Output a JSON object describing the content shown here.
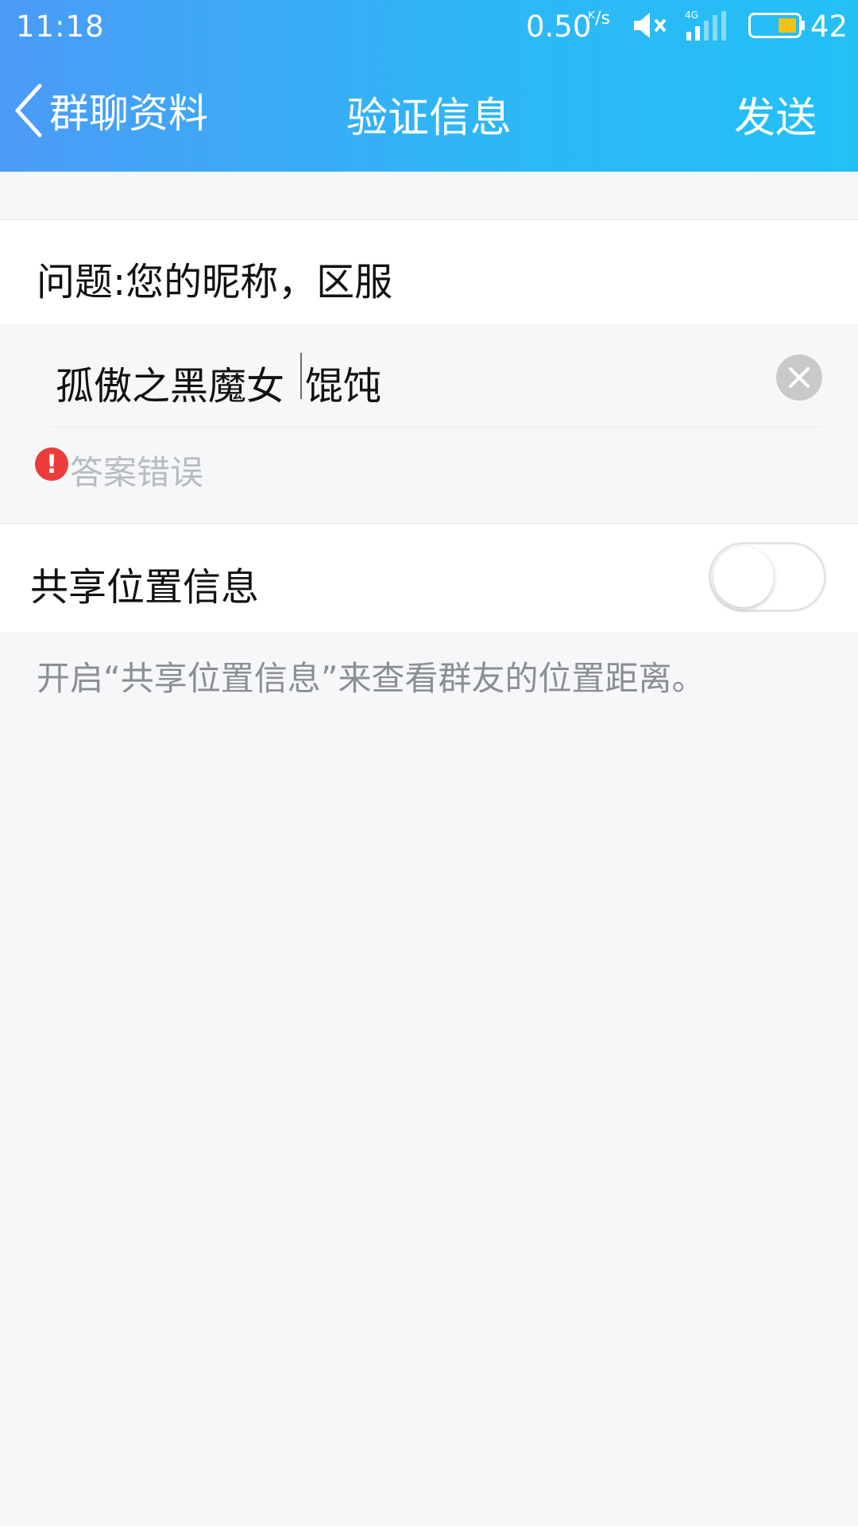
{
  "status_bar": {
    "time": "11:18",
    "network_speed": "0.50",
    "network_speed_unit": "K/s",
    "signal_type": "4G",
    "battery_level": "42",
    "icons": [
      "mute-icon",
      "signal-icon",
      "battery-icon"
    ]
  },
  "nav": {
    "back_label": "群聊资料",
    "title": "验证信息",
    "send_label": "发送"
  },
  "form": {
    "question": "问题:您的昵称，区服",
    "answer_part1": "孤傲之黑魔女 ",
    "answer_part2": "馄饨",
    "error_text": "答案错误",
    "error_icon_glyph": "!"
  },
  "share_location": {
    "label": "共享位置信息",
    "enabled": false,
    "hint": "开启“共享位置信息”来查看群友的位置距离。"
  },
  "colors": {
    "header_start": "#4b9bf7",
    "header_end": "#23c0f6",
    "error": "#ee3b3b",
    "background": "#f6f7f9"
  }
}
